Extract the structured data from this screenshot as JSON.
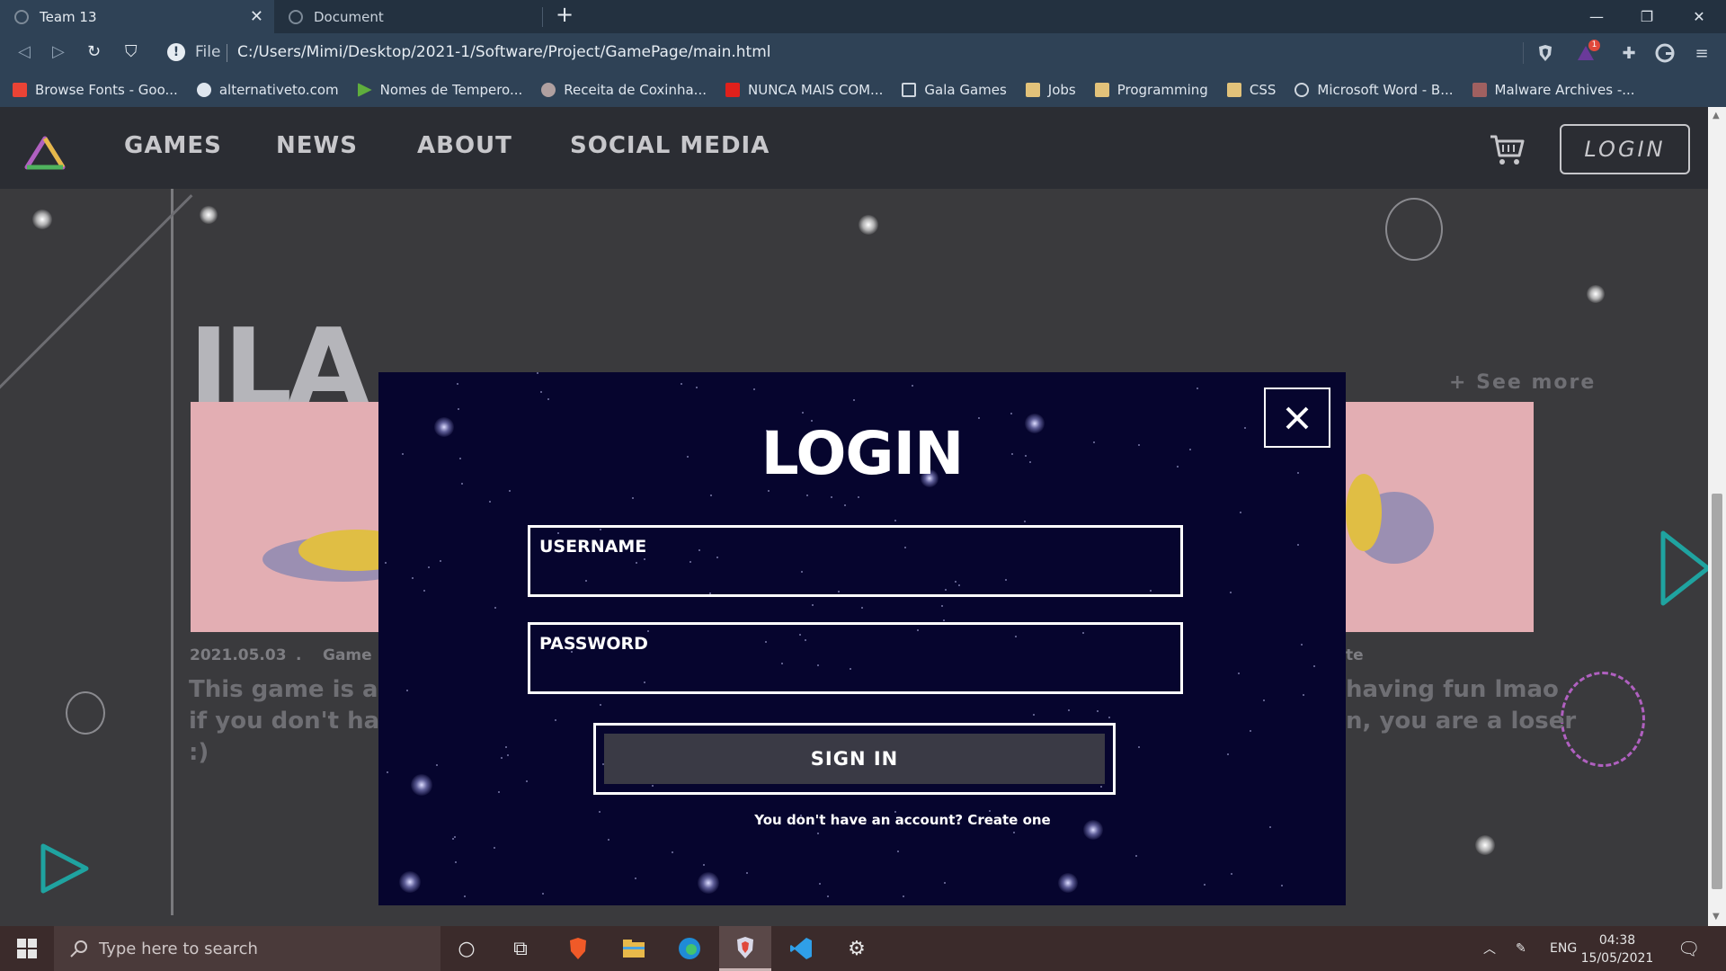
{
  "browser": {
    "tabs": [
      {
        "title": "Team 13",
        "active": true
      },
      {
        "title": "Document",
        "active": false
      }
    ],
    "address": {
      "scheme": "File",
      "url": "C:/Users/Mimi/Desktop/2021-1/Software/Project/GamePage/main.html"
    },
    "extension_badge": "1",
    "bookmarks": [
      {
        "label": "Browse Fonts - Goo...",
        "icon": "google-fonts-icon",
        "color": "#ea4335"
      },
      {
        "label": "alternativeto.com",
        "icon": "alternativeto-icon",
        "color": "#dfe6ee"
      },
      {
        "label": "Nomes de Tempero...",
        "icon": "arrow-site-icon",
        "color": "#5fae3d"
      },
      {
        "label": "Receita de Coxinha...",
        "icon": "recipe-icon",
        "color": "#b0a0a0"
      },
      {
        "label": "NUNCA MAIS COM...",
        "icon": "youtube-icon",
        "color": "#e0201b"
      },
      {
        "label": "Gala Games",
        "icon": "gala-icon",
        "color": "#cfd6de"
      },
      {
        "label": "Jobs",
        "icon": "folder-icon",
        "color": "#e2c27a"
      },
      {
        "label": "Programming",
        "icon": "folder-icon",
        "color": "#e2c27a"
      },
      {
        "label": "CSS",
        "icon": "folder-icon",
        "color": "#e2c27a"
      },
      {
        "label": "Microsoft Word - B...",
        "icon": "globe-icon",
        "color": "#cfd6de"
      },
      {
        "label": "Malware Archives -...",
        "icon": "malware-site-icon",
        "color": "#a06060"
      }
    ]
  },
  "site": {
    "nav": [
      "GAMES",
      "NEWS",
      "ABOUT",
      "SOCIAL MEDIA"
    ],
    "login_button": "LOGIN",
    "big_title": "ILA",
    "see_more": "+ See more",
    "card_left": {
      "date": "2021.05.03",
      "dot": ".",
      "category": "Game U",
      "text_lines": [
        "This game is abo",
        "if you don't have",
        ":)"
      ]
    },
    "card_right": {
      "category": "te",
      "text_lines": [
        "having fun lmao",
        "n, you are a loser"
      ]
    }
  },
  "modal": {
    "title": "LOGIN",
    "username_label": "USERNAME",
    "password_label": "PASSWORD",
    "sign_in": "SIGN IN",
    "create_account": "You don't have an account? Create one"
  },
  "taskbar": {
    "search_placeholder": "Type here to search",
    "language": "ENG",
    "time": "04:38",
    "date": "15/05/2021"
  },
  "colors": {
    "modal_bg": "#06052e",
    "site_bg": "#3a3a3d",
    "nav_bg": "#2b2d33",
    "accent_teal": "#1fa3a0",
    "accent_purple": "#b060c0"
  }
}
